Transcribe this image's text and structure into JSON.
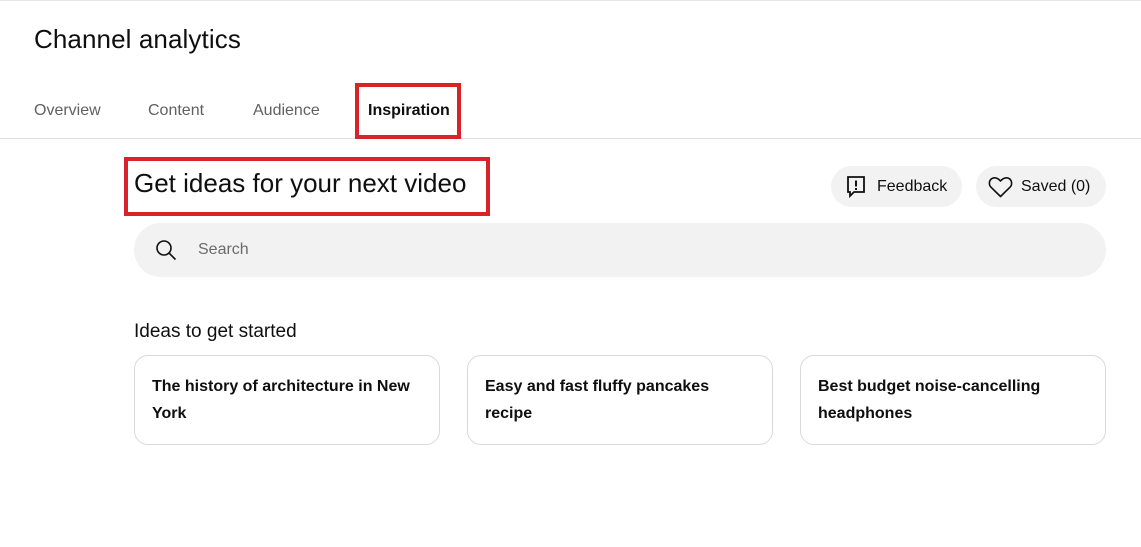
{
  "header": {
    "title": "Channel analytics"
  },
  "tabs": [
    {
      "label": "Overview"
    },
    {
      "label": "Content"
    },
    {
      "label": "Audience"
    },
    {
      "label": "Inspiration"
    }
  ],
  "main": {
    "heading": "Get ideas for your next video",
    "feedback_button": {
      "label": "Feedback",
      "icon": "feedback-flag-icon"
    },
    "saved_button": {
      "label": "Saved (0)",
      "icon": "heart-icon"
    },
    "search": {
      "placeholder": "Search",
      "value": "",
      "icon": "search-icon"
    },
    "ideas_title": "Ideas to get started",
    "ideas": [
      {
        "text": "The history of architecture in New York"
      },
      {
        "text": "Easy and fast fluffy pancakes recipe"
      },
      {
        "text": "Best budget noise-cancelling headphones"
      }
    ]
  },
  "colors": {
    "highlight": "#d8232a",
    "pill_bg": "#f2f2f2",
    "text": "#0f0f0f",
    "muted": "#606060"
  }
}
